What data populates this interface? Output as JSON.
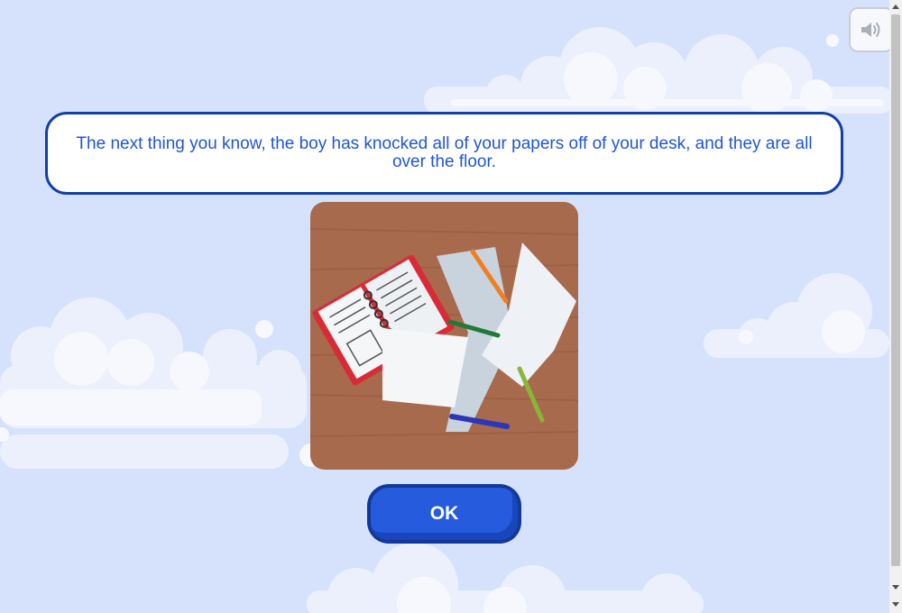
{
  "dialog": {
    "message": "The next thing you know, the boy has knocked all of your papers off of your desk, and they are all over the floor."
  },
  "buttons": {
    "ok_label": "OK",
    "sound_icon": "speaker-volume-icon"
  },
  "illustration": {
    "subject": "scattered-papers-on-desk"
  },
  "colors": {
    "background": "#d6e2fb",
    "dialog_border": "#1240a8",
    "dialog_text": "#1f56d3",
    "button_fill": "#265bde",
    "desk_wood": "#a86a4c"
  }
}
